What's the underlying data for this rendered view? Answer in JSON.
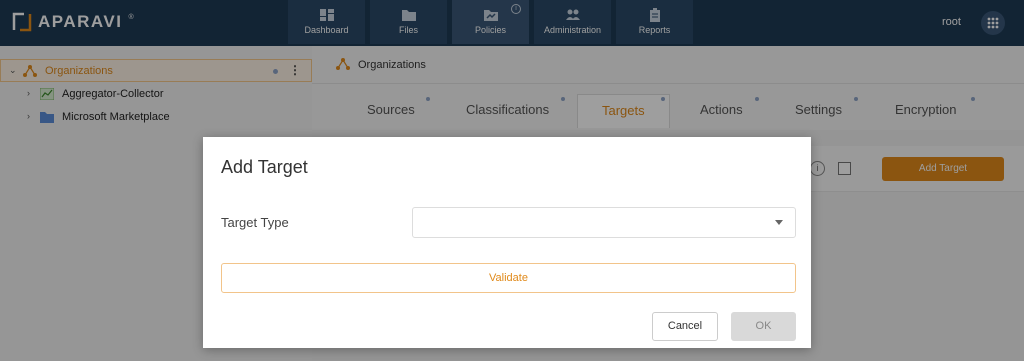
{
  "app": {
    "name": "APARAVI",
    "trademark": "®"
  },
  "nav": [
    {
      "label": "Dashboard",
      "icon": "dashboard-icon"
    },
    {
      "label": "Files",
      "icon": "folder-icon"
    },
    {
      "label": "Policies",
      "icon": "policies-icon",
      "active": true,
      "info": "i"
    },
    {
      "label": "Administration",
      "icon": "users-icon"
    },
    {
      "label": "Reports",
      "icon": "clipboard-icon"
    }
  ],
  "user": {
    "name": "root"
  },
  "sidebar": {
    "items": [
      {
        "label": "Organizations",
        "icon": "organization-icon",
        "selected": true
      },
      {
        "label": "Aggregator-Collector",
        "icon": "collector-icon"
      },
      {
        "label": "Microsoft Marketplace",
        "icon": "folder-icon"
      }
    ]
  },
  "breadcrumb": {
    "label": "Organizations"
  },
  "tabs": [
    {
      "label": "Sources"
    },
    {
      "label": "Classifications"
    },
    {
      "label": "Targets",
      "active": true
    },
    {
      "label": "Actions"
    },
    {
      "label": "Settings"
    },
    {
      "label": "Encryption"
    }
  ],
  "panel": {
    "add_target_label": "Add Target"
  },
  "dialog": {
    "title": "Add Target",
    "target_type_label": "Target Type",
    "target_type_value": "",
    "validate_label": "Validate",
    "cancel_label": "Cancel",
    "ok_label": "OK"
  },
  "colors": {
    "brand": "#1d3a55",
    "accent": "#e08a1b",
    "dot": "#8fa4c7"
  }
}
